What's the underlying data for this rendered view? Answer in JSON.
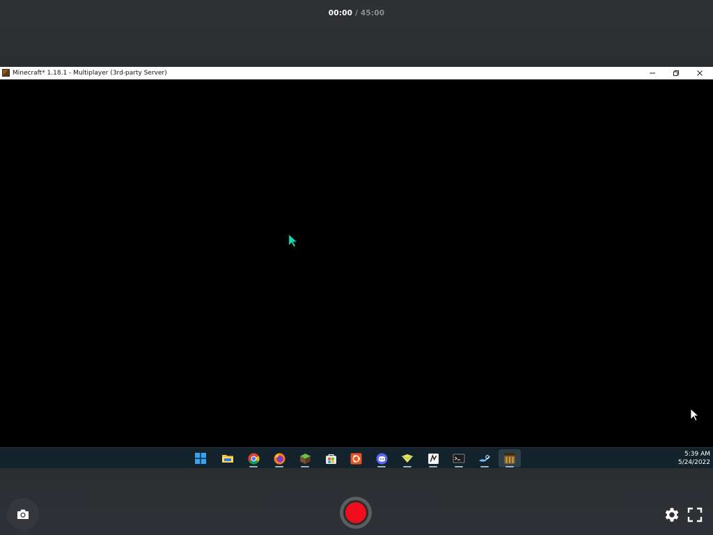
{
  "recorder": {
    "elapsed": "00:00",
    "separator": " / ",
    "total": "45:00",
    "record_color": "#f00d1c"
  },
  "window": {
    "title": "Minecraft* 1.18.1 - Multiplayer (3rd-party Server)",
    "icon": "minecraft-block-icon",
    "controls": [
      "minimize-icon",
      "restore-icon",
      "close-icon"
    ]
  },
  "taskbar": {
    "items": [
      {
        "name": "windows-start-icon",
        "open": false
      },
      {
        "name": "file-explorer-icon",
        "open": false
      },
      {
        "name": "chrome-icon",
        "open": true
      },
      {
        "name": "firefox-icon",
        "open": true
      },
      {
        "name": "minecraft-launcher-icon",
        "open": true
      },
      {
        "name": "microsoft-store-icon",
        "open": false
      },
      {
        "name": "ubuntu-icon",
        "open": false
      },
      {
        "name": "discord-icon",
        "open": true
      },
      {
        "name": "notes-icon",
        "open": true
      },
      {
        "name": "app-icon",
        "open": true
      },
      {
        "name": "terminal-icon",
        "open": true
      },
      {
        "name": "steam-icon",
        "open": true
      },
      {
        "name": "minecraft-icon",
        "open": true,
        "active": true
      }
    ],
    "time": "5:39 AM",
    "date": "5/24/2022"
  },
  "controls": {
    "screenshot": "camera-icon",
    "record": "record-icon",
    "settings": "gear-icon",
    "fullscreen": "fullscreen-icon"
  }
}
